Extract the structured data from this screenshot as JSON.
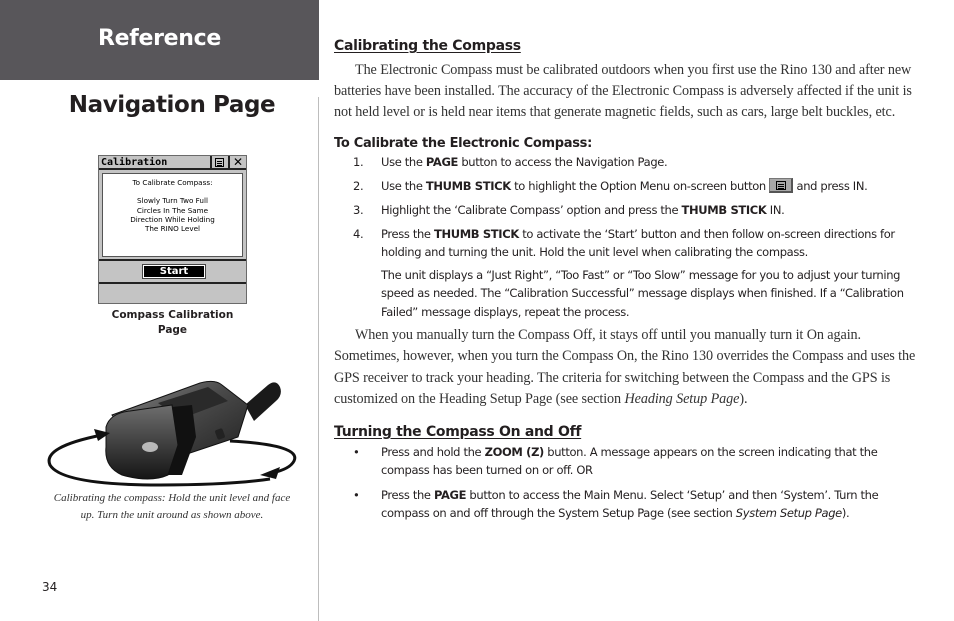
{
  "header": {
    "section_title": "Reference",
    "page_title": "Navigation Page"
  },
  "figure1": {
    "screen": {
      "title": "Calibration",
      "menu_icon": "option-menu-icon",
      "close_icon": "close-icon",
      "close_glyph": "✕",
      "message_line1": "To Calibrate Compass:",
      "message_lines": [
        "Slowly Turn Two Full",
        "Circles In The Same",
        "Direction While Holding",
        "The RINO Level"
      ],
      "start_button": "Start"
    },
    "caption_line1": "Compass Calibration",
    "caption_line2": "Page"
  },
  "figure2": {
    "image": "rino-device-rotation-illustration",
    "caption_line1": "Calibrating the compass: Hold the unit level and face",
    "caption_line2": "up.  Turn the unit around as shown above."
  },
  "page_number": "34",
  "main": {
    "section1": {
      "heading": "Calibrating the Compass",
      "intro": "The Electronic Compass must be calibrated outdoors when you first use the Rino 130 and after new batteries have been installed. The accuracy of the Electronic Compass is adversely affected if the unit is not held level or is held near items that generate magnetic fields, such as cars, large belt buckles, etc.",
      "procedure_heading": "To Calibrate the Electronic Compass:",
      "steps": [
        {
          "num": "1.",
          "pre": "Use the ",
          "bold": "PAGE",
          "post": " button to access the Navigation Page."
        },
        {
          "num": "2.",
          "pre": "Use the ",
          "bold": "THUMB STICK",
          "post": " to highlight the Option Menu on-screen button ",
          "post2": " and press IN."
        },
        {
          "num": "3.",
          "pre": "Highlight the ‘Calibrate Compass’ option and press the ",
          "bold": "THUMB STICK",
          "post": " IN."
        },
        {
          "num": "4.",
          "pre": "Press the ",
          "bold": "THUMB STICK",
          "post": " to activate the ‘Start’ button and then follow on-screen directions for holding and turning the unit.  Hold the unit level when calibrating the compass."
        }
      ],
      "step4_note": "The unit displays a “Just Right”, “Too Fast” or “Too Slow” message for you to adjust your turning speed as needed.  The “Calibration Successful” message displays when finished.  If a “Calibration Failed” message displays, repeat the process.",
      "paragraph2_pre": "When you manually turn the Compass Off, it stays off until you manually turn it On again. Sometimes, however, when you turn the Compass On, the Rino 130 overrides the Compass and uses the GPS receiver to track your heading. The criteria for switching between the Compass and the GPS is customized on the Heading Setup Page (see section ",
      "paragraph2_italic": "Heading Setup Page",
      "paragraph2_post": ")."
    },
    "section2": {
      "heading": "Turning the Compass On and Off",
      "bullets": [
        {
          "pre": "Press and hold the ",
          "bold": "ZOOM (Z)",
          "post": " button.  A message appears on the screen indicating that the compass has been turned on or off.  OR"
        },
        {
          "pre": "Press the ",
          "bold": "PAGE",
          "post": " button to access the Main Menu.  Select ‘Setup’ and then ‘System’.  Turn the compass on and off through the System Setup Page (see section ",
          "italic": "System Setup Page",
          "post2": ")."
        }
      ]
    }
  },
  "colors": {
    "header_band": "#58565a",
    "text": "#231f20",
    "divider": "#bdbdbd"
  }
}
